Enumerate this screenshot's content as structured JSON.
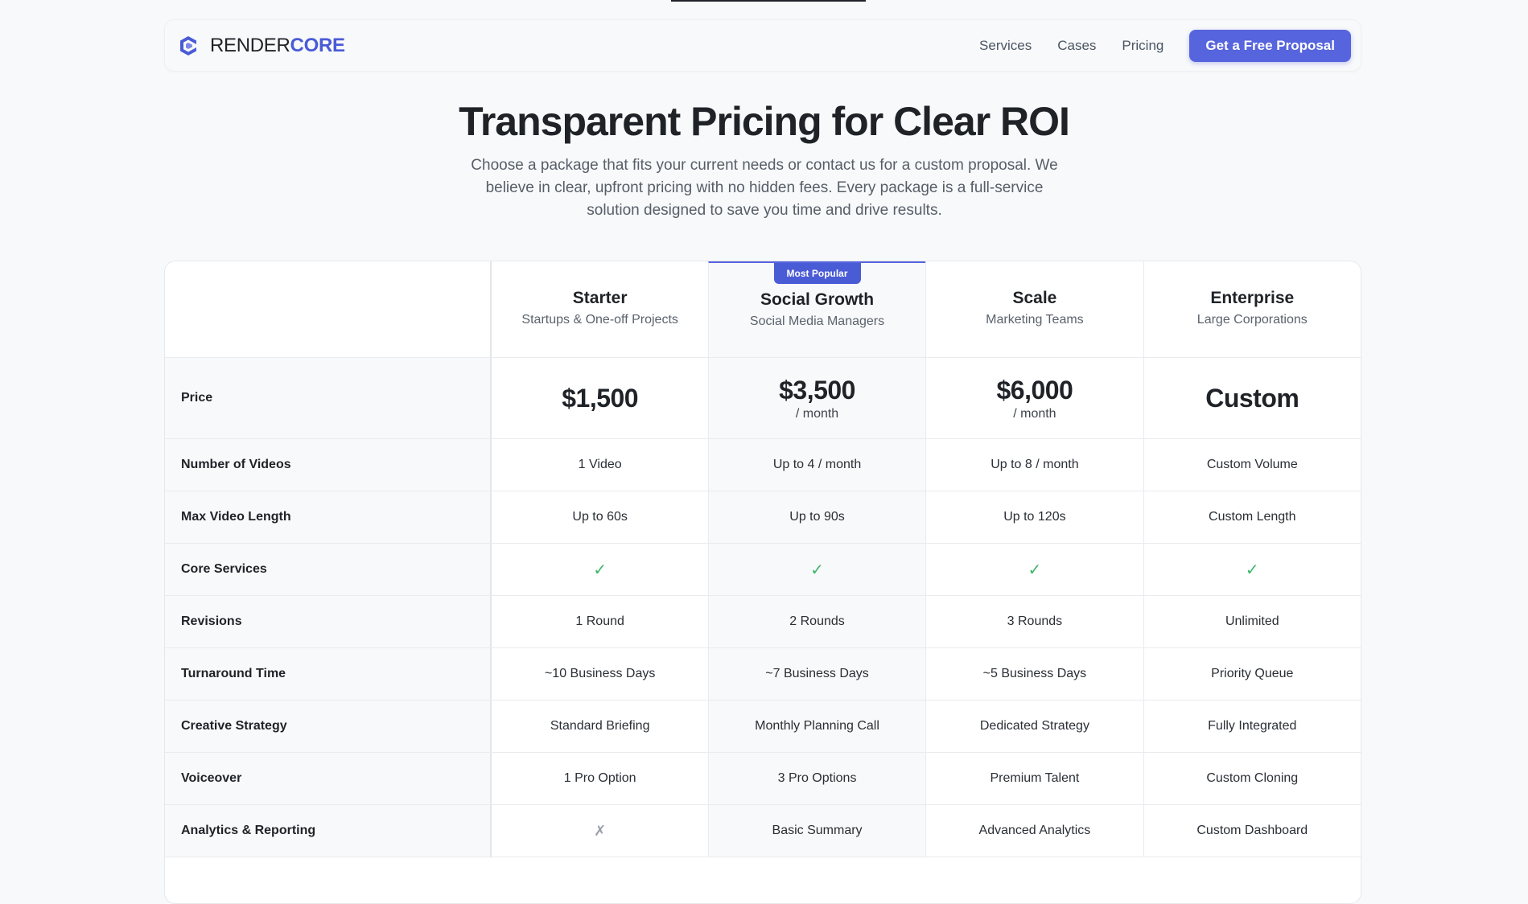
{
  "brand": {
    "name_part1": "RENDER",
    "name_part2": "CORE",
    "accent": "#4a5bd6"
  },
  "nav": {
    "items": [
      "Services",
      "Cases",
      "Pricing"
    ],
    "cta": "Get a Free Proposal"
  },
  "hero": {
    "title": "Transparent Pricing for Clear ROI",
    "subtitle": "Choose a package that fits your current needs or contact us for a custom proposal. We believe in clear, upfront pricing with no hidden fees. Every package is a full-service solution designed to save you time and drive results."
  },
  "plans": [
    {
      "name": "Starter",
      "audience": "Startups & One-off Projects",
      "price": "$1,500",
      "unit": ""
    },
    {
      "name": "Social Growth",
      "audience": "Social Media Managers",
      "price": "$3,500",
      "unit": "/ month",
      "badge": "Most Popular"
    },
    {
      "name": "Scale",
      "audience": "Marketing Teams",
      "price": "$6,000",
      "unit": "/ month"
    },
    {
      "name": "Enterprise",
      "audience": "Large Corporations",
      "price": "Custom",
      "unit": ""
    }
  ],
  "price_label": "Price",
  "features": [
    {
      "label": "Number of Videos",
      "values": [
        "1 Video",
        "Up to 4 / month",
        "Up to 8 / month",
        "Custom Volume"
      ]
    },
    {
      "label": "Max Video Length",
      "values": [
        "Up to 60s",
        "Up to 90s",
        "Up to 120s",
        "Custom Length"
      ]
    },
    {
      "label": "Core Services",
      "values": [
        "✓",
        "✓",
        "✓",
        "✓"
      ]
    },
    {
      "label": "Revisions",
      "values": [
        "1 Round",
        "2 Rounds",
        "3 Rounds",
        "Unlimited"
      ]
    },
    {
      "label": "Turnaround Time",
      "values": [
        "~10 Business Days",
        "~7 Business Days",
        "~5 Business Days",
        "Priority Queue"
      ]
    },
    {
      "label": "Creative Strategy",
      "values": [
        "Standard Briefing",
        "Monthly Planning Call",
        "Dedicated Strategy",
        "Fully Integrated"
      ]
    },
    {
      "label": "Voiceover",
      "values": [
        "1 Pro Option",
        "3 Pro Options",
        "Premium Talent",
        "Custom Cloning"
      ]
    },
    {
      "label": "Analytics & Reporting",
      "values": [
        "✗",
        "Basic Summary",
        "Advanced Analytics",
        "Custom Dashboard"
      ]
    }
  ]
}
